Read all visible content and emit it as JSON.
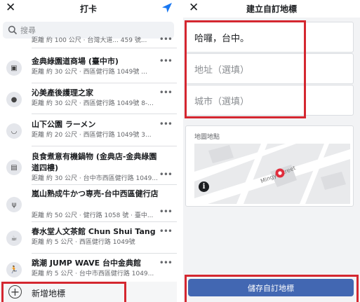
{
  "left_panel": {
    "title": "打卡",
    "search_placeholder": "搜尋",
    "partial_row_sub": "距離 約 100 公尺 · 台灣大道... 459 號...",
    "places": [
      {
        "name": "金典綠園道商場 (臺中市)",
        "sub": "距離 約 30 公尺 · 西區健行路 1049號 ...",
        "icon": "shopping-bag-icon"
      },
      {
        "name": "沁美產後護理之家",
        "sub": "距離 約 30 公尺 · 西區健行路 1049號 8-...",
        "icon": "map-pin-icon"
      },
      {
        "name": "山下公園 ラーメン",
        "sub": "距離 約 20 公尺 · 西區健行路 1049號 3...",
        "icon": "bowl-icon"
      },
      {
        "name": "良食煮意有機鍋物 (金典店-金典綠園道四樓)",
        "sub": "距離 約 30 公尺 · 台中市西區健行路 1049...",
        "icon": "cooking-pot-icon"
      },
      {
        "name": "嵐山熟成牛かつ専売-台中西區健行店",
        "sub": "距離 約 50 公尺 · 健行路 1058 號 · 臺中...",
        "icon": "utensils-icon"
      },
      {
        "name": "春水堂人文茶館 Chun Shui Tang",
        "sub": "距離 約 5 公尺 · 西區健行路 1049號",
        "icon": "teacup-icon"
      },
      {
        "name": "跳潮 JUMP WAVE 台中金典館",
        "sub": "距離 約 5 公尺 · 台中市西區健行路 1049...",
        "icon": "runner-icon"
      }
    ],
    "add_place_label": "新增地標"
  },
  "right_panel": {
    "title": "建立自訂地標",
    "name_value": "哈囉，台中。",
    "address_placeholder": "地址（選填）",
    "city_placeholder": "城市（選填）",
    "map_label": "地圖地點",
    "street_name": "Mingyi Street",
    "save_label": "儲存自訂地標"
  },
  "colors": {
    "accent": "#4267b2",
    "highlight_box": "#d42730",
    "nav_blue": "#1877f2"
  }
}
